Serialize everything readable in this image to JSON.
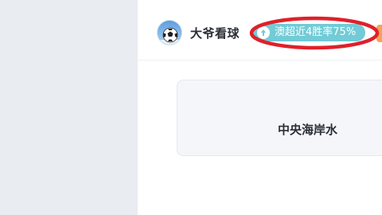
{
  "post": {
    "author": {
      "name": "大爷看球",
      "avatar_icon": "soccer-ball-avatar-icon"
    },
    "badge": {
      "icon": "up-arrow-icon",
      "text": "澳超近4胜率75%",
      "color": "#72cbd6"
    },
    "card": {
      "title": "中央海岸水"
    }
  },
  "annotation": {
    "color": "#e0202a",
    "shape": "ellipse"
  },
  "colors": {
    "sidebar_background": "#e9ecf0",
    "card_background": "#f5f6f9"
  }
}
